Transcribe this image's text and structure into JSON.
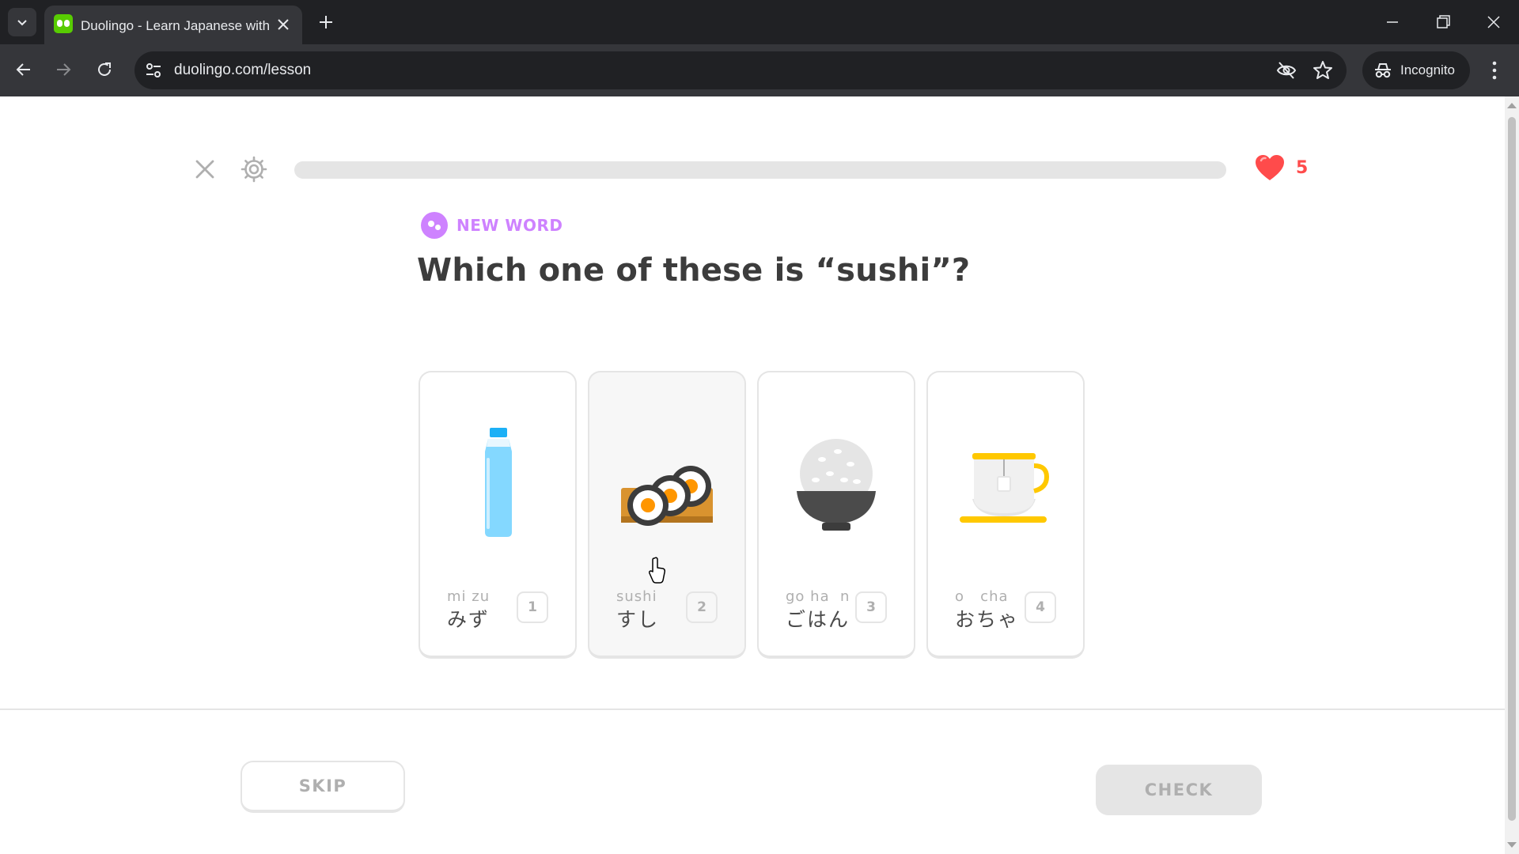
{
  "browser": {
    "tab_title": "Duolingo - Learn Japanese with",
    "url": "duolingo.com/lesson",
    "incognito_label": "Incognito"
  },
  "lesson": {
    "progress_fraction": 0.0,
    "hearts": "5",
    "badge_label": "NEW WORD",
    "question": "Which one of these is “sushi”?",
    "choices": [
      {
        "romaji": "mi zu",
        "kana": "みず",
        "key": "1",
        "icon": "water-bottle-icon"
      },
      {
        "romaji": "sushi",
        "kana": "すし",
        "key": "2",
        "icon": "sushi-icon"
      },
      {
        "romaji": "go ha  n",
        "kana": "ごはん",
        "key": "3",
        "icon": "rice-bowl-icon"
      },
      {
        "romaji": "o   cha",
        "kana": "おちゃ",
        "key": "4",
        "icon": "tea-cup-icon"
      }
    ],
    "skip_label": "SKIP",
    "check_label": "CHECK"
  },
  "colors": {
    "accent_green": "#58cc02",
    "new_word_purple": "#ce82ff",
    "heart_red": "#ff4b4b",
    "border_gray": "#e5e5e5",
    "text_dark": "#3c3c3c"
  }
}
